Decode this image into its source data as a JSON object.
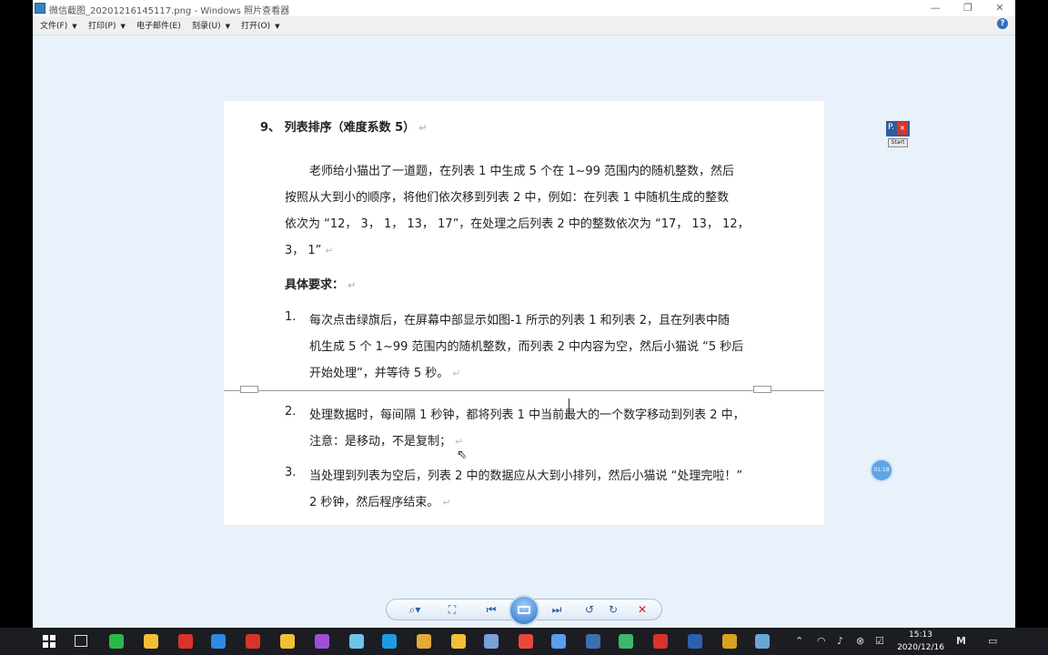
{
  "window": {
    "title": "微信截图_20201216145117.png - Windows 照片查看器",
    "minimize": "—",
    "maximize": "❐",
    "close": "✕"
  },
  "menu": {
    "items": [
      {
        "label": "文件(F)",
        "caret": "▼"
      },
      {
        "label": "打印(P)",
        "caret": "▼"
      },
      {
        "label": "电子邮件(E)",
        "caret": ""
      },
      {
        "label": "刻录(U)",
        "caret": "▼"
      },
      {
        "label": "打开(O)",
        "caret": "▼"
      }
    ],
    "help": "?"
  },
  "document": {
    "heading": "9、 列表排序（难度系数 5）",
    "para_lines": [
      "老师给小猫出了一道题，在列表 1 中生成 5 个在 1~99 范围内的随机整数，然后",
      "按照从大到小的顺序，将他们依次移到列表 2 中，例如：在列表 1 中随机生成的整数",
      "依次为 “12， 3， 1， 13， 17”，在处理之后列表 2 中的整数依次为 “17， 13， 12，",
      "3， 1”"
    ],
    "req_title": "具体要求：",
    "items": [
      {
        "num": "1.",
        "lines": [
          "每次点击绿旗后，在屏幕中部显示如图-1 所示的列表 1 和列表 2，且在列表中随",
          "机生成 5 个 1~99 范围内的随机整数，而列表 2 中内容为空，然后小猫说 “5 秒后",
          "开始处理”，并等待 5 秒。"
        ]
      },
      {
        "num": "2.",
        "lines": [
          "处理数据时，每间隔 1 秒钟，都将列表 1 中当前最大的一个数字移动到列表 2 中，",
          "注意：是移动，不是复制；"
        ]
      },
      {
        "num": "3.",
        "lines": [
          "当处理到列表为空后，列表 2 中的数据应从大到小排列，然后小猫说 “处理完啦！”",
          "2 秒钟，然后程序结束。"
        ]
      }
    ],
    "para_mark": "↵"
  },
  "widget": {
    "p_label": "P.",
    "close_label": "×",
    "start_label": "Start"
  },
  "timer": {
    "label": "01:18"
  },
  "toolbar": {
    "zoom": "⌕▾",
    "actual_size": "⛶",
    "prev": "⏮",
    "next": "⏭",
    "rotate_left": "↺",
    "rotate_right": "↻",
    "delete": "✕"
  },
  "taskbar": {
    "time": "15:13",
    "date": "2020/12/16",
    "colors": [
      "#2db84a",
      "#f2c037",
      "#d9342b",
      "#2b8be3",
      "#d9342b",
      "#f2c037",
      "#a04ed8",
      "#6ec4e8",
      "#1e9be3",
      "#e2a93b",
      "#f2c037",
      "#7aa0d8",
      "#e8483a",
      "#5a9cf0",
      "#3b6fb0",
      "#3cb86a",
      "#d9342b",
      "#2b5fb0",
      "#d9a21e",
      "#6aa5d8"
    ]
  }
}
